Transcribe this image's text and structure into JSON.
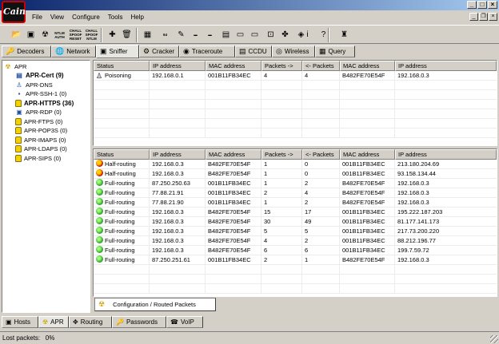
{
  "app": {
    "icon_text": "Cain",
    "win_minimize": "_",
    "win_maximize": "□",
    "win_close": "×"
  },
  "menu": [
    "File",
    "View",
    "Configure",
    "Tools",
    "Help"
  ],
  "mdi": {
    "minimize": "_",
    "restore": "❐",
    "close": "×"
  },
  "toolbar": {
    "items": [
      {
        "icon": "folder-icon",
        "glyph": "📂"
      },
      {
        "icon": "network-card-icon",
        "glyph": "▣"
      },
      {
        "icon": "radiation-icon",
        "glyph": "☢"
      },
      {
        "icon": "ntlm-auth-icon",
        "label": "NTLM AUTH"
      },
      {
        "icon": "chall-spoof-reset-icon",
        "label": "CHALL SPOOF RESET"
      },
      {
        "icon": "chall-spoof-ntlm-icon",
        "label": "CHALL SPOOF NTLM"
      },
      {
        "icon": "plus-icon",
        "glyph": "✚"
      },
      {
        "icon": "trash-icon",
        "glyph": "🗑"
      },
      {
        "icon": "hash-calc-icon",
        "glyph": "▦"
      },
      {
        "icon": "base64-icon",
        "label": "64"
      },
      {
        "icon": "cert-icon",
        "glyph": "✎"
      },
      {
        "icon": "ntlm-green-icon",
        "label": "▬"
      },
      {
        "icon": "lm-green-icon",
        "label": "▬"
      },
      {
        "icon": "route-icon",
        "glyph": "▤"
      },
      {
        "icon": "terminal-icon",
        "glyph": "▭"
      },
      {
        "icon": "monitor-icon",
        "glyph": "▭"
      },
      {
        "icon": "disk-icon",
        "glyph": "⊡"
      },
      {
        "icon": "puzzle-icon",
        "glyph": "✤"
      },
      {
        "icon": "globe-icon",
        "glyph": "◈"
      },
      {
        "icon": "info-icon",
        "glyph": "i"
      },
      {
        "icon": "help-icon",
        "glyph": "?"
      },
      {
        "icon": "logo-icon",
        "glyph": "♜"
      }
    ]
  },
  "top_tabs": [
    "Decoders",
    "Network",
    "Sniffer",
    "Cracker",
    "Traceroute",
    "CCDU",
    "Wireless",
    "Query"
  ],
  "tree": {
    "root": "APR",
    "items": [
      {
        "label": "APR-Cert (9)",
        "bold": true,
        "icon": "cert-icon"
      },
      {
        "label": "APR-DNS",
        "bold": false,
        "icon": "dns-icon"
      },
      {
        "label": "APR-SSH-1 (0)",
        "bold": false,
        "icon": "terminal-icon"
      },
      {
        "label": "APR-HTTPS (36)",
        "bold": true,
        "icon": "lock-icon"
      },
      {
        "label": "APR-RDP (0)",
        "bold": false,
        "icon": "rdp-icon"
      },
      {
        "label": "APR-FTPS (0)",
        "bold": false,
        "icon": "lock-icon"
      },
      {
        "label": "APR-POP3S (0)",
        "bold": false,
        "icon": "lock-icon"
      },
      {
        "label": "APR-IMAPS (0)",
        "bold": false,
        "icon": "lock-icon"
      },
      {
        "label": "APR-LDAPS (0)",
        "bold": false,
        "icon": "lock-icon"
      },
      {
        "label": "APR-SIPS (0)",
        "bold": false,
        "icon": "lock-icon"
      }
    ]
  },
  "columns": [
    "Status",
    "IP address",
    "MAC address",
    "Packets ->",
    "<- Packets",
    "MAC address",
    "IP address"
  ],
  "top_table": [
    {
      "status": "Poisoning",
      "kind": "poison",
      "ip1": "192.168.0.1",
      "mac1": "001B11FB34EC",
      "out": "4",
      "in": "4",
      "mac2": "B482FE70E54F",
      "ip2": "192.168.0.3"
    }
  ],
  "bottom_table": [
    {
      "status": "Half-routing",
      "kind": "half",
      "ip1": "192.168.0.3",
      "mac1": "B482FE70E54F",
      "out": "1",
      "in": "0",
      "mac2": "001B11FB34EC",
      "ip2": "213.180.204.69"
    },
    {
      "status": "Half-routing",
      "kind": "half",
      "ip1": "192.168.0.3",
      "mac1": "B482FE70E54F",
      "out": "1",
      "in": "0",
      "mac2": "001B11FB34EC",
      "ip2": "93.158.134.44"
    },
    {
      "status": "Full-routing",
      "kind": "full",
      "ip1": "87.250.250.63",
      "mac1": "001B11FB34EC",
      "out": "1",
      "in": "2",
      "mac2": "B482FE70E54F",
      "ip2": "192.168.0.3"
    },
    {
      "status": "Full-routing",
      "kind": "full",
      "ip1": "77.88.21.91",
      "mac1": "001B11FB34EC",
      "out": "2",
      "in": "4",
      "mac2": "B482FE70E54F",
      "ip2": "192.168.0.3"
    },
    {
      "status": "Full-routing",
      "kind": "full",
      "ip1": "77.88.21.90",
      "mac1": "001B11FB34EC",
      "out": "1",
      "in": "2",
      "mac2": "B482FE70E54F",
      "ip2": "192.168.0.3"
    },
    {
      "status": "Full-routing",
      "kind": "full",
      "ip1": "192.168.0.3",
      "mac1": "B482FE70E54F",
      "out": "15",
      "in": "17",
      "mac2": "001B11FB34EC",
      "ip2": "195.222.187.203"
    },
    {
      "status": "Full-routing",
      "kind": "full",
      "ip1": "192.168.0.3",
      "mac1": "B482FE70E54F",
      "out": "30",
      "in": "49",
      "mac2": "001B11FB34EC",
      "ip2": "81.177.141.173"
    },
    {
      "status": "Full-routing",
      "kind": "full",
      "ip1": "192.168.0.3",
      "mac1": "B482FE70E54F",
      "out": "5",
      "in": "5",
      "mac2": "001B11FB34EC",
      "ip2": "217.73.200.220"
    },
    {
      "status": "Full-routing",
      "kind": "full",
      "ip1": "192.168.0.3",
      "mac1": "B482FE70E54F",
      "out": "4",
      "in": "2",
      "mac2": "001B11FB34EC",
      "ip2": "88.212.196.77"
    },
    {
      "status": "Full-routing",
      "kind": "full",
      "ip1": "192.168.0.3",
      "mac1": "B482FE70E54F",
      "out": "6",
      "in": "6",
      "mac2": "001B11FB34EC",
      "ip2": "199.7.59.72"
    },
    {
      "status": "Full-routing",
      "kind": "full",
      "ip1": "87.250.251.61",
      "mac1": "001B11FB34EC",
      "out": "2",
      "in": "1",
      "mac2": "B482FE70E54F",
      "ip2": "192.168.0.3"
    }
  ],
  "config_tab": "Configuration / Routed Packets",
  "bottom_tabs": [
    "Hosts",
    "APR",
    "Routing",
    "Passwords",
    "VoIP"
  ],
  "status": "Lost packets:   0%"
}
